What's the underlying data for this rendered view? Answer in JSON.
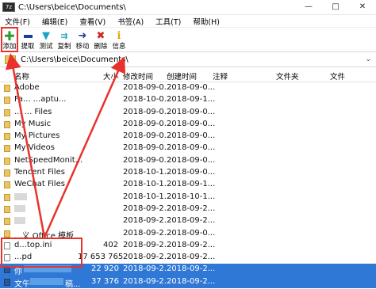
{
  "window": {
    "title": "C:\\Users\\beice\\Documents\\",
    "app_icon": "7z",
    "controls": [
      "—",
      "□",
      "✕"
    ]
  },
  "menu": [
    "文件(F)",
    "编辑(E)",
    "查看(V)",
    "书签(A)",
    "工具(T)",
    "帮助(H)"
  ],
  "toolbar": [
    {
      "icon": "plus-icon",
      "label": "添加",
      "color": "#2e9e2e"
    },
    {
      "icon": "minus-icon",
      "label": "提取",
      "color": "#1a3fa3"
    },
    {
      "icon": "check-icon",
      "label": "测试",
      "color": "#1fa0c9"
    },
    {
      "icon": "double-arrow-icon",
      "label": "复制",
      "color": "#1fa0c9"
    },
    {
      "icon": "arrow-right-icon",
      "label": "移动",
      "color": "#1a3fa3"
    },
    {
      "icon": "x-icon",
      "label": "删除",
      "color": "#d02525"
    },
    {
      "icon": "info-icon",
      "label": "信息",
      "color": "#e0a800"
    }
  ],
  "address": "C:\\Users\\beice\\Documents\\",
  "columns": {
    "name": "名称",
    "size": "大小",
    "modified": "修改时间",
    "created": "创建时间",
    "comment": "注释",
    "folders": "文件夹",
    "files": "文件"
  },
  "files": [
    {
      "name": "Adobe",
      "size": "",
      "modified": "2018-09-0...",
      "created": "2018-09-0...",
      "type": "folder"
    },
    {
      "name": "Fa... ...aptu...",
      "size": "",
      "modified": "2018-10-0...",
      "created": "2018-09-1...",
      "type": "folder"
    },
    {
      "name": "... ... Files",
      "size": "",
      "modified": "2018-09-0...",
      "created": "2018-09-0...",
      "type": "folder"
    },
    {
      "name": "My Music",
      "size": "",
      "modified": "2018-09-0...",
      "created": "2018-09-0...",
      "type": "folder"
    },
    {
      "name": "My Pictures",
      "size": "",
      "modified": "2018-09-0...",
      "created": "2018-09-0...",
      "type": "folder"
    },
    {
      "name": "My Videos",
      "size": "",
      "modified": "2018-09-0...",
      "created": "2018-09-0...",
      "type": "folder"
    },
    {
      "name": "NetSpeedMonit...",
      "size": "",
      "modified": "2018-09-0...",
      "created": "2018-09-0...",
      "type": "folder"
    },
    {
      "name": "Tencent Files",
      "size": "",
      "modified": "2018-10-1...",
      "created": "2018-09-0...",
      "type": "folder"
    },
    {
      "name": "WeChat Files",
      "size": "",
      "modified": "2018-10-1...",
      "created": "2018-09-1...",
      "type": "folder"
    },
    {
      "name": "",
      "size": "",
      "modified": "2018-10-1...",
      "created": "2018-10-1...",
      "type": "folder"
    },
    {
      "name": "",
      "size": "",
      "modified": "2018-09-2...",
      "created": "2018-09-2...",
      "type": "folder"
    },
    {
      "name": "",
      "size": "",
      "modified": "2018-09-2...",
      "created": "2018-09-2...",
      "type": "folder"
    },
    {
      "name": "...义 Office 模板",
      "size": "",
      "modified": "2018-09-2...",
      "created": "2018-09-0...",
      "type": "folder"
    },
    {
      "name": "d...top.ini",
      "size": "402",
      "modified": "2018-09-2...",
      "created": "2018-09-2...",
      "type": "file"
    },
    {
      "name": "...pd",
      "size": "17 653 765",
      "modified": "2018-09-2...",
      "created": "2018-09-2...",
      "type": "file"
    },
    {
      "name": "你",
      "size": "22 920",
      "modified": "2018-09-2...",
      "created": "2018-09-2...",
      "type": "doc",
      "selected": true
    },
    {
      "name": "文午",
      "size": "37 376",
      "modified": "2018-09-2...",
      "created": "2018-09-2...",
      "type": "doc",
      "selected": true,
      "suffix": "稿..."
    }
  ],
  "colors": {
    "selection": "#3078d6",
    "annotation": "#e8322d"
  }
}
